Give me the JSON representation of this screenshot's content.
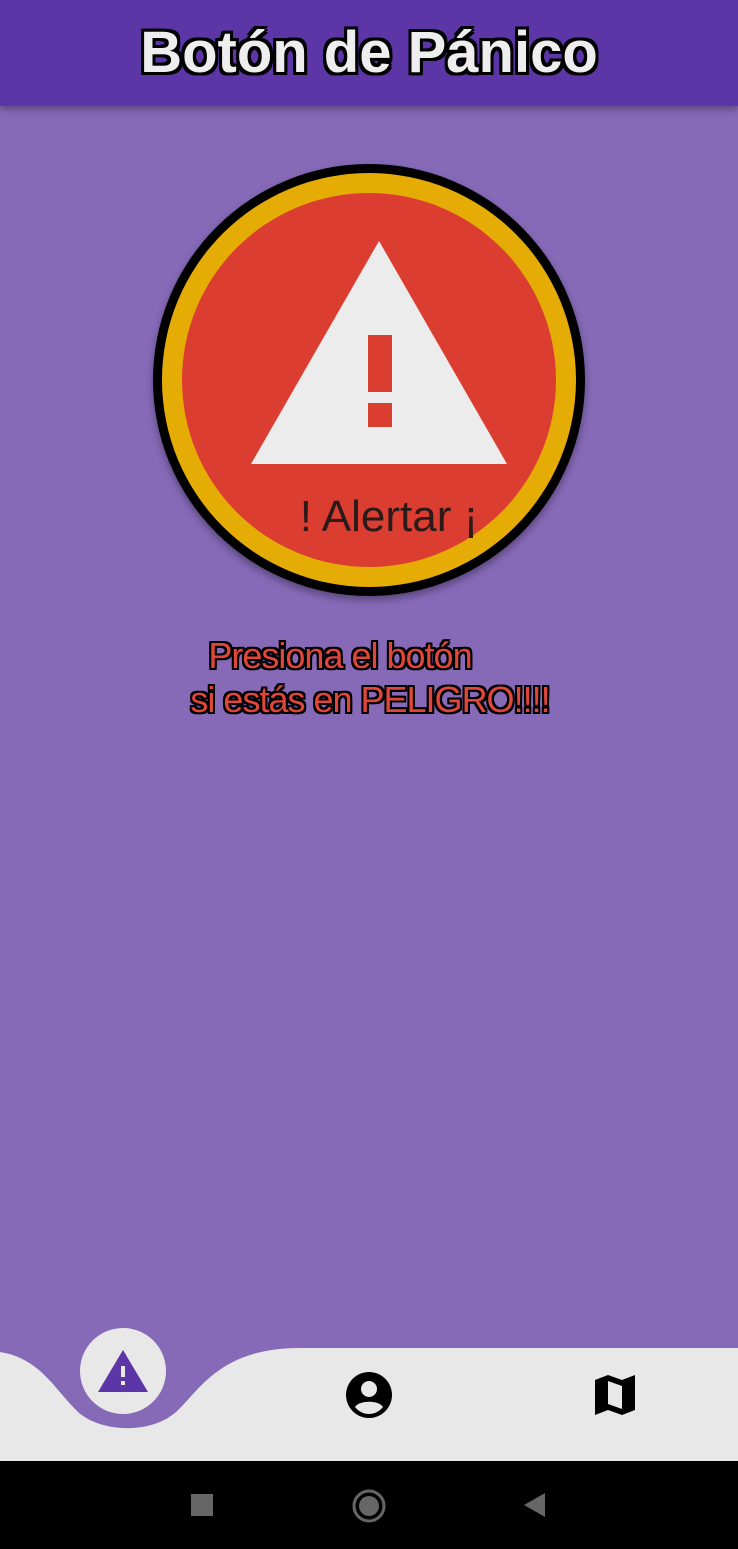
{
  "app_bar": {
    "title": "Botón de Pánico"
  },
  "panic_button": {
    "icon": "warning-icon",
    "label": "! Alertar ¡"
  },
  "instruction": {
    "line1": "Presiona el botón",
    "line2": "si estás en PELIGRO!!!!"
  },
  "bottom_nav": {
    "items": [
      {
        "icon": "warning-icon",
        "active": true
      },
      {
        "icon": "account-circle-icon",
        "active": false
      },
      {
        "icon": "map-icon",
        "active": false
      }
    ]
  },
  "system_nav": {
    "items": [
      "recent-apps-icon",
      "home-icon",
      "back-icon"
    ]
  },
  "colors": {
    "background": "#866ab8",
    "app_bar": "#5c35a6",
    "panic_red": "#dc3d31",
    "panic_ring": "#e6ac06",
    "nav_bar": "#e8e8e8",
    "active_icon": "#5c35a6"
  }
}
